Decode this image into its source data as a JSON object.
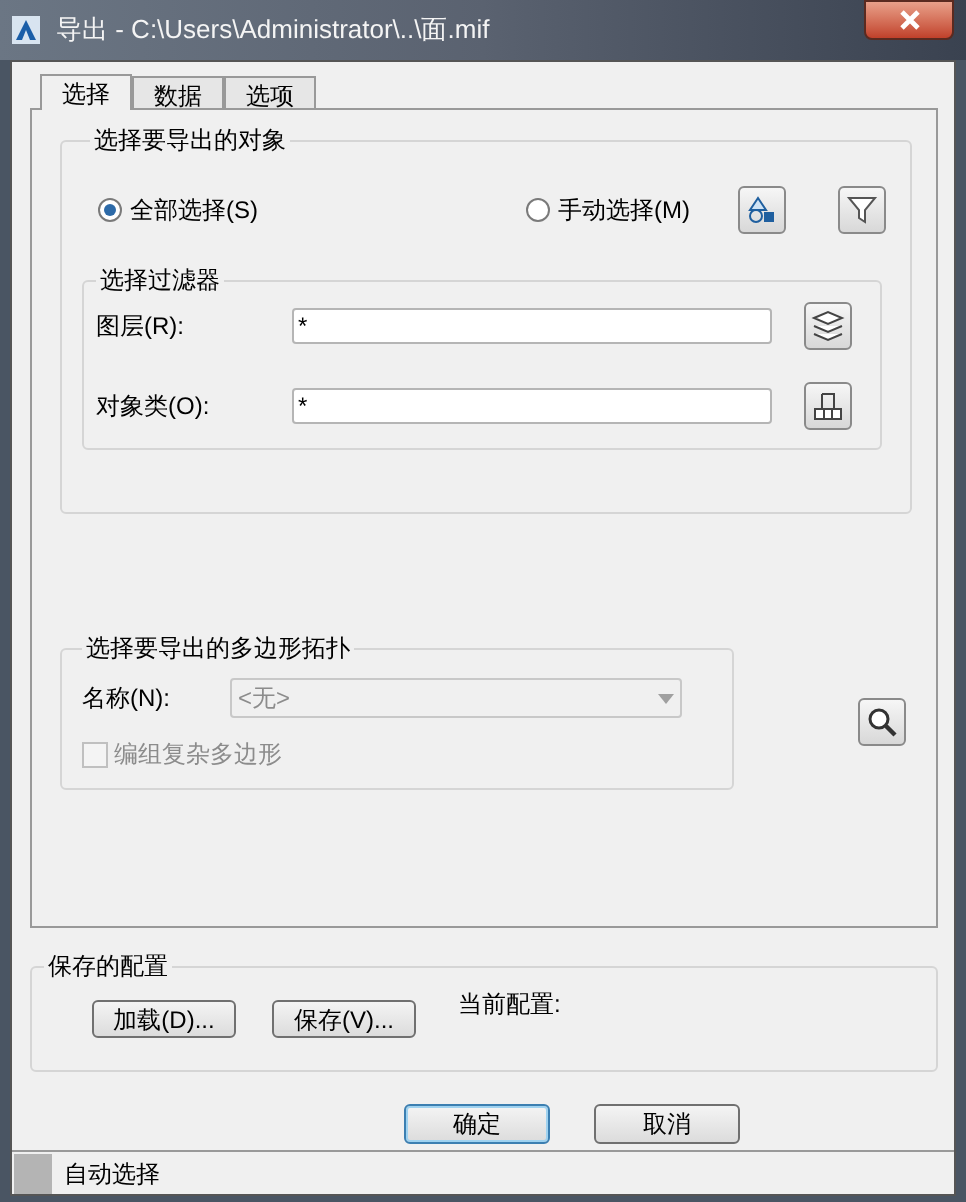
{
  "window": {
    "title": "导出 - C:\\Users\\Administrator\\..\\面.mif"
  },
  "tabs": [
    {
      "label": "选择",
      "selected": true
    },
    {
      "label": "数据",
      "selected": false
    },
    {
      "label": "选项",
      "selected": false
    }
  ],
  "object_group": {
    "title": "选择要导出的对象",
    "options": [
      {
        "label": "全部选择(S)",
        "selected": true
      },
      {
        "label": "手动选择(M)",
        "selected": false
      }
    ],
    "filter": {
      "title": "选择过滤器",
      "fields": [
        {
          "label": "图层(R):",
          "value": "*"
        },
        {
          "label": "对象类(O):",
          "value": "*"
        }
      ]
    }
  },
  "topology_group": {
    "title": "选择要导出的多边形拓扑",
    "name_label": "名称(N):",
    "name_value": "<无>",
    "disabled": true,
    "checkbox": {
      "label": "编组复杂多边形",
      "checked": false,
      "disabled": true
    }
  },
  "saved_config": {
    "title": "保存的配置",
    "buttons": [
      "加载(D)...",
      "保存(V)..."
    ],
    "current_label": "当前配置:"
  },
  "buttons": [
    {
      "label": "确定",
      "default": true
    },
    {
      "label": "取消",
      "default": false
    }
  ],
  "status_bar": {
    "text": "自动选择"
  }
}
